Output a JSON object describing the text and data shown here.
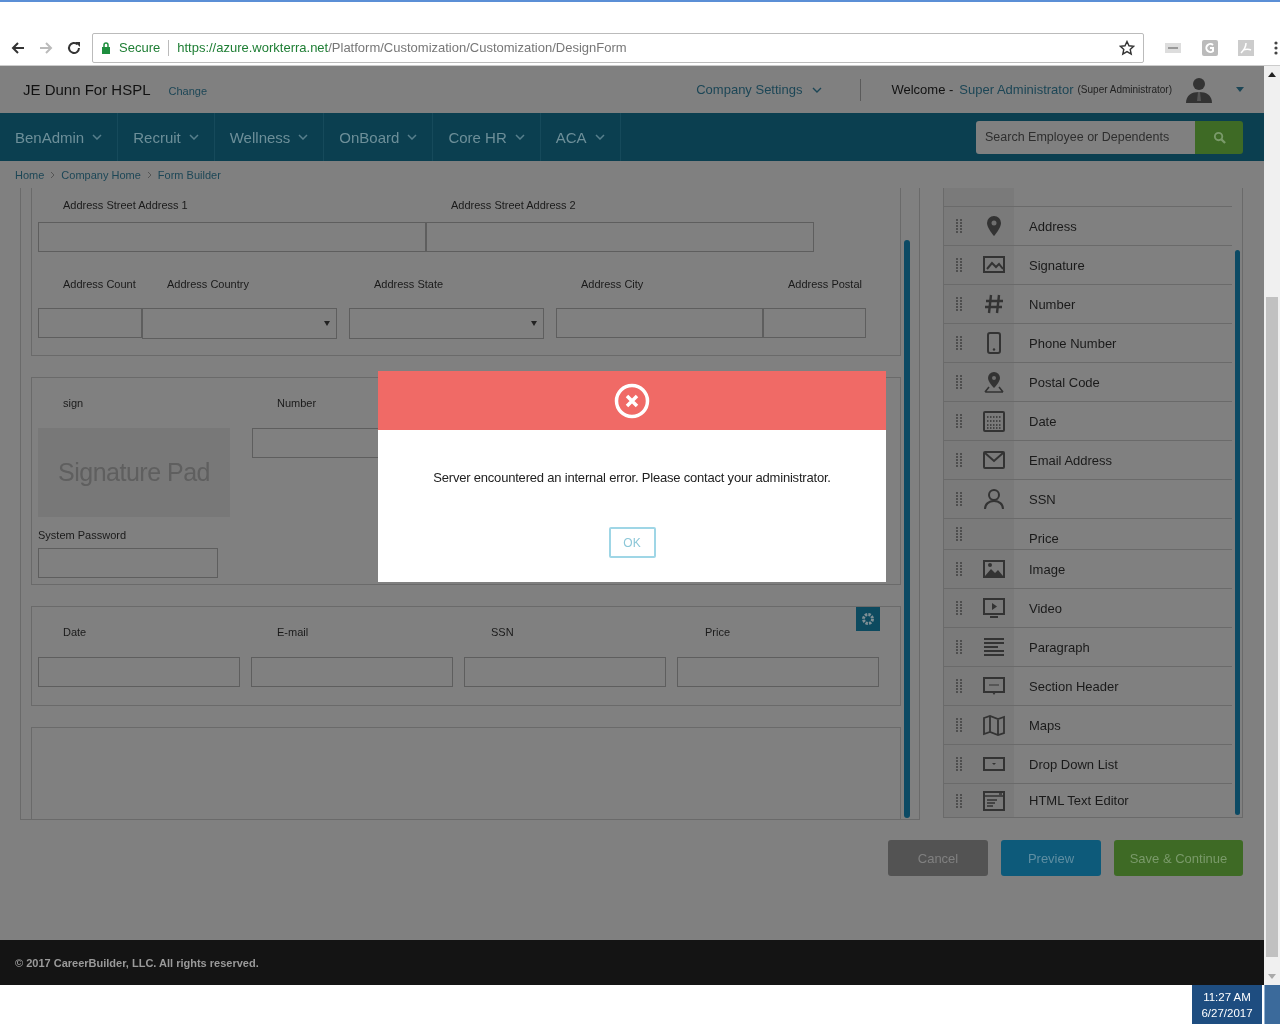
{
  "browser": {
    "secure": "Secure",
    "url_host": "https://azure.workterra.net",
    "url_path": "/Platform/Customization/Customization/DesignForm"
  },
  "header": {
    "company": "JE Dunn For HSPL",
    "change": "Change",
    "settings": "Company Settings",
    "welcome": "Welcome -",
    "user": "Super Administrator",
    "role": "(Super Administrator)"
  },
  "nav": {
    "menus": [
      "BenAdmin",
      "Recruit",
      "Wellness",
      "OnBoard",
      "Core HR",
      "ACA"
    ],
    "search": {
      "placeholder": "Search Employee or Dependents"
    }
  },
  "breadcrumb": [
    "Home",
    "Company Home",
    "Form Builder"
  ],
  "form": {
    "address": {
      "labels": [
        "Address Street Address 1",
        "Address Street Address 2",
        "Address Count",
        "Address Country",
        "Address State",
        "Address City",
        "Address Postal"
      ]
    },
    "sign": {
      "sign_label": "sign",
      "pad": "Signature Pad",
      "number_label": "Number",
      "password_label": "System Password"
    },
    "contact": {
      "labels": [
        "Date",
        "E-mail",
        "SSN",
        "Price"
      ]
    }
  },
  "palette": [
    {
      "label": "Address",
      "kind": "pin"
    },
    {
      "label": "Signature",
      "kind": "signature"
    },
    {
      "label": "Number",
      "kind": "hash"
    },
    {
      "label": "Phone Number",
      "kind": "phone"
    },
    {
      "label": "Postal Code",
      "kind": "postal"
    },
    {
      "label": "Date",
      "kind": "calendar"
    },
    {
      "label": "Email Address",
      "kind": "mail"
    },
    {
      "label": "SSN",
      "kind": "person"
    },
    {
      "label": "Price",
      "kind": "none"
    },
    {
      "label": "Image",
      "kind": "image"
    },
    {
      "label": "Video",
      "kind": "video"
    },
    {
      "label": "Paragraph",
      "kind": "paragraph"
    },
    {
      "label": "Section Header",
      "kind": "textbox"
    },
    {
      "label": "Maps",
      "kind": "map"
    },
    {
      "label": "Drop Down List",
      "kind": "dropdown"
    },
    {
      "label": "HTML Text Editor",
      "kind": "editor"
    }
  ],
  "buttons": {
    "cancel": "Cancel",
    "preview": "Preview",
    "save": "Save & Continue"
  },
  "footer": "© 2017 CareerBuilder, LLC. All rights reserved.",
  "modal": {
    "message": "Server encountered an internal error. Please contact your administrator.",
    "ok": "OK"
  },
  "taskbar": {
    "time": "11:27 AM",
    "date": "6/27/2017"
  }
}
